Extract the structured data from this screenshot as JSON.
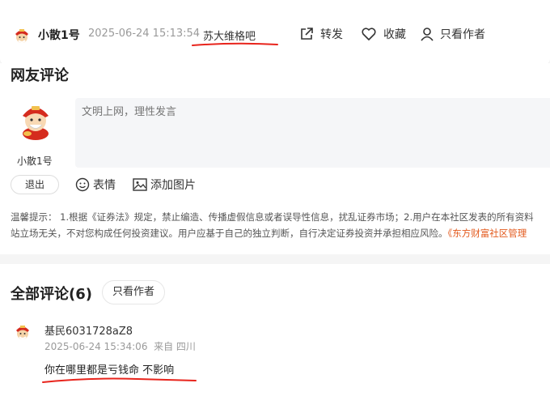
{
  "header": {
    "username": "小散1号",
    "timestamp": "2025-06-24 15:13:54",
    "bar_name": "苏大维格吧",
    "actions": {
      "share_label": "转发",
      "favorite_label": "收藏",
      "author_only_label": "只看作者"
    }
  },
  "comment_box": {
    "title": "网友评论",
    "username": "小散1号",
    "placeholder": "文明上网，理性发言",
    "logout_label": "退出",
    "emoji_label": "表情",
    "image_label": "添加图片",
    "notice_line1": "温馨提示： 1.根据《证券法》规定，禁止编造、传播虚假信息或者误导性信息，扰乱证券市场；2.用户在本社区发表的所有资料",
    "notice_line2_prefix": "站立场无关，不对您构成任何投资建议。用户应基于自己的独立判断，自行决定证券投资并承担相应风险。",
    "notice_link": "《东方财富社区管理"
  },
  "all_comments": {
    "title": "全部评论(6)",
    "author_only_label": "只看作者",
    "items": [
      {
        "username": "基民6031728aZ8",
        "meta": "2025-06-24 15:34:06  来自 四川",
        "text": "你在哪里都是亏钱命 不影响"
      }
    ]
  },
  "colors": {
    "accent_red": "#e8241c",
    "link_orange": "#e35a1d",
    "muted_gray": "#9a9a9a"
  },
  "icons": [
    "avatar-icon",
    "share-icon",
    "heart-icon",
    "user-icon",
    "emoji-icon",
    "image-icon"
  ]
}
